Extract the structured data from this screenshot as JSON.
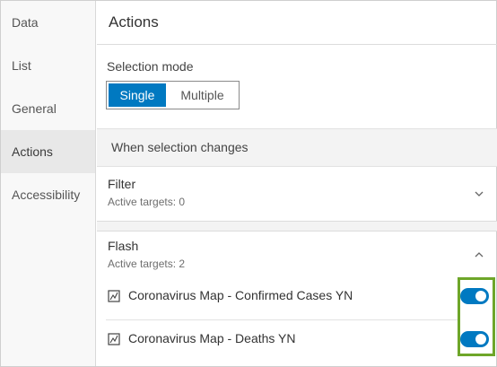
{
  "sidebar": {
    "items": [
      {
        "label": "Data"
      },
      {
        "label": "List"
      },
      {
        "label": "General"
      },
      {
        "label": "Actions"
      },
      {
        "label": "Accessibility"
      }
    ],
    "active": "Actions"
  },
  "header": {
    "title": "Actions"
  },
  "selection": {
    "label": "Selection mode",
    "options": [
      "Single",
      "Multiple"
    ],
    "selected": "Single"
  },
  "when": {
    "label": "When selection changes"
  },
  "filter": {
    "title": "Filter",
    "subtitle": "Active targets: 0",
    "expanded": false
  },
  "flash": {
    "title": "Flash",
    "subtitle": "Active targets: 2",
    "expanded": true,
    "layers": [
      {
        "label": "Coronavirus Map - Confirmed Cases YN",
        "enabled": true
      },
      {
        "label": "Coronavirus Map - Deaths YN",
        "enabled": true
      }
    ]
  },
  "colors": {
    "accent": "#0079c1",
    "highlight": "#6ea629"
  },
  "icons": {
    "filter_chevron": "chevron-down-icon",
    "flash_chevron": "chevron-up-icon",
    "layer": "map-layer-icon"
  }
}
